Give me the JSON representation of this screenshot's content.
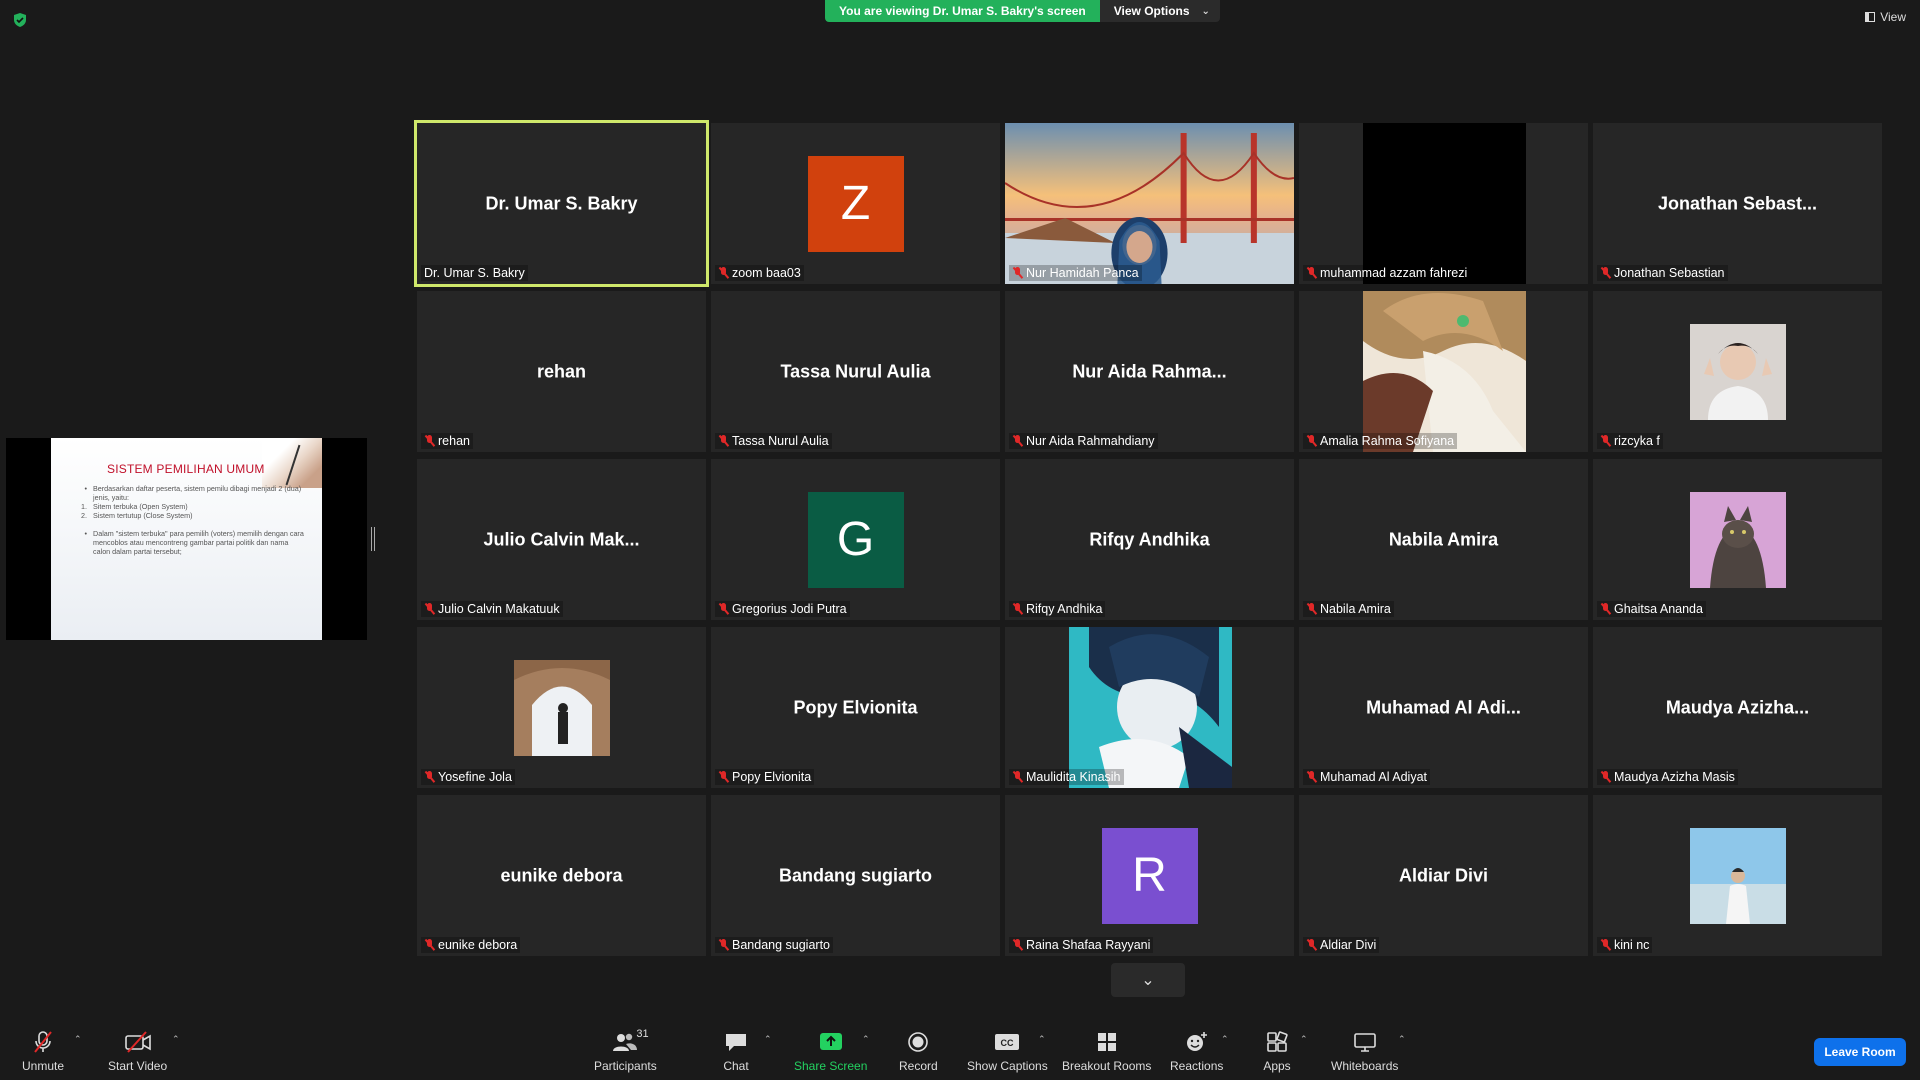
{
  "banner": {
    "viewing_text": "You are viewing Dr. Umar S. Bakry's screen",
    "view_options": "View Options",
    "view": "View"
  },
  "shared_slide": {
    "title": "SISTEM PEMILIHAN UMUM",
    "lines": [
      {
        "marker": "•",
        "text": "Berdasarkan daftar peserta, sistem pemilu dibagi menjadi 2 (dua) jenis, yaitu:"
      },
      {
        "marker": "1.",
        "text": "Sitem terbuka (Open System)"
      },
      {
        "marker": "2.",
        "text": "Sistem tertutup (Close System)"
      },
      {
        "marker": "•",
        "text": "Dalam \"sistem terbuka\" para pemilih (voters) memilih dengan cara mencoblos atau mencontreng gambar partai politik dan nama calon dalam partai tersebut;"
      }
    ]
  },
  "participants": [
    {
      "label": "Dr. Umar S. Bakry",
      "display": "Dr. Umar S. Bakry",
      "type": "name",
      "muted": false,
      "active": true
    },
    {
      "label": "zoom baa03",
      "display": "Z",
      "type": "letter",
      "color": "#d1410d",
      "muted": true
    },
    {
      "label": "Nur Hamidah Panca",
      "display": "",
      "type": "video-bridge",
      "muted": true
    },
    {
      "label": "muhammad azzam fahrezi",
      "display": "",
      "type": "video-black",
      "muted": true
    },
    {
      "label": "Jonathan Sebastian",
      "display": "Jonathan Sebast...",
      "type": "name",
      "muted": true
    },
    {
      "label": "rehan",
      "display": "rehan",
      "type": "name",
      "muted": true
    },
    {
      "label": "Tassa Nurul Aulia",
      "display": "Tassa Nurul Aulia",
      "type": "name",
      "muted": true
    },
    {
      "label": "Nur Aida Rahmahdiany",
      "display": "Nur Aida Rahma...",
      "type": "name",
      "muted": true
    },
    {
      "label": "Amalia Rahma Sofiyana",
      "display": "",
      "type": "video-anime",
      "muted": true
    },
    {
      "label": "rizcyka f",
      "display": "",
      "type": "photo-person",
      "muted": true
    },
    {
      "label": "Julio Calvin Makatuuk",
      "display": "Julio Calvin Mak...",
      "type": "name",
      "muted": true
    },
    {
      "label": "Gregorius Jodi Putra",
      "display": "G",
      "type": "letter",
      "color": "#0a5c44",
      "muted": true
    },
    {
      "label": "Rifqy Andhika",
      "display": "Rifqy Andhika",
      "type": "name",
      "muted": true
    },
    {
      "label": "Nabila Amira",
      "display": "Nabila Amira",
      "type": "name",
      "muted": true
    },
    {
      "label": "Ghaitsa Ananda",
      "display": "",
      "type": "photo-cat",
      "muted": true
    },
    {
      "label": "Yosefine Jola",
      "display": "",
      "type": "photo-arch",
      "muted": true
    },
    {
      "label": "Popy Elvionita",
      "display": "Popy Elvionita",
      "type": "name",
      "muted": true
    },
    {
      "label": "Maulidita Kinasih",
      "display": "",
      "type": "video-anime2",
      "muted": true
    },
    {
      "label": "Muhamad Al Adiyat",
      "display": "Muhamad Al Adi...",
      "type": "name",
      "muted": true
    },
    {
      "label": "Maudya Azizha Masis",
      "display": "Maudya Azizha...",
      "type": "name",
      "muted": true
    },
    {
      "label": "eunike debora",
      "display": "eunike debora",
      "type": "name",
      "muted": true
    },
    {
      "label": "Bandang sugiarto",
      "display": "Bandang sugiarto",
      "type": "name",
      "muted": true
    },
    {
      "label": "Raina Shafaa Rayyani",
      "display": "R",
      "type": "letter",
      "color": "#7a4fd0",
      "muted": true
    },
    {
      "label": "Aldiar Divi",
      "display": "Aldiar Divi",
      "type": "name",
      "muted": true
    },
    {
      "label": "kini nc",
      "display": "",
      "type": "photo-beach",
      "muted": true
    }
  ],
  "toolbar": {
    "unmute": "Unmute",
    "start_video": "Start Video",
    "participants": "Participants",
    "participants_count": "31",
    "chat": "Chat",
    "share_screen": "Share Screen",
    "record": "Record",
    "show_captions": "Show Captions",
    "breakout_rooms": "Breakout Rooms",
    "reactions": "Reactions",
    "apps": "Apps",
    "whiteboards": "Whiteboards",
    "leave_room": "Leave Room"
  }
}
